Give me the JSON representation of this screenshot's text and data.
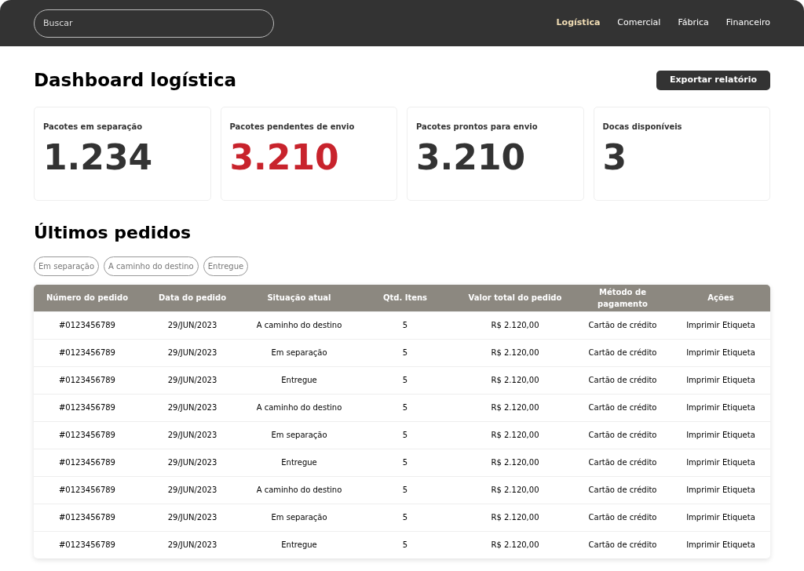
{
  "search": {
    "placeholder": "Buscar"
  },
  "nav": [
    {
      "label": "Logística",
      "selected": true
    },
    {
      "label": "Comercial",
      "selected": false
    },
    {
      "label": "Fábrica",
      "selected": false
    },
    {
      "label": "Financeiro",
      "selected": false
    }
  ],
  "page_title": "Dashboard logística",
  "export_button": "Exportar relatório",
  "stats": [
    {
      "label": "Pacotes em separação",
      "value": "1.234",
      "alert": false
    },
    {
      "label": "Pacotes pendentes de envio",
      "value": "3.210",
      "alert": true
    },
    {
      "label": "Pacotes prontos para envio",
      "value": "3.210",
      "alert": false
    },
    {
      "label": "Docas disponíveis",
      "value": "3",
      "alert": false
    }
  ],
  "orders_title": "Últimos pedidos",
  "filters": [
    "Em separação",
    "A caminho do destino",
    "Entregue"
  ],
  "table": {
    "columns": [
      "Número do pedido",
      "Data do pedido",
      "Situação atual",
      "Qtd. Itens",
      "Valor total do pedido",
      "Método de pagamento",
      "Ações"
    ],
    "rows": [
      [
        "#0123456789",
        "29/JUN/2023",
        "A caminho do destino",
        "5",
        "R$ 2.120,00",
        "Cartão de crédito",
        "Imprimir Etiqueta"
      ],
      [
        "#0123456789",
        "29/JUN/2023",
        "Em separação",
        "5",
        "R$ 2.120,00",
        "Cartão de crédito",
        "Imprimir Etiqueta"
      ],
      [
        "#0123456789",
        "29/JUN/2023",
        "Entregue",
        "5",
        "R$ 2.120,00",
        "Cartão de crédito",
        "Imprimir Etiqueta"
      ],
      [
        "#0123456789",
        "29/JUN/2023",
        "A caminho do destino",
        "5",
        "R$ 2.120,00",
        "Cartão de crédito",
        "Imprimir Etiqueta"
      ],
      [
        "#0123456789",
        "29/JUN/2023",
        "Em separação",
        "5",
        "R$ 2.120,00",
        "Cartão de crédito",
        "Imprimir Etiqueta"
      ],
      [
        "#0123456789",
        "29/JUN/2023",
        "Entregue",
        "5",
        "R$ 2.120,00",
        "Cartão de crédito",
        "Imprimir Etiqueta"
      ],
      [
        "#0123456789",
        "29/JUN/2023",
        "A caminho do destino",
        "5",
        "R$ 2.120,00",
        "Cartão de crédito",
        "Imprimir Etiqueta"
      ],
      [
        "#0123456789",
        "29/JUN/2023",
        "Em separação",
        "5",
        "R$ 2.120,00",
        "Cartão de crédito",
        "Imprimir Etiqueta"
      ],
      [
        "#0123456789",
        "29/JUN/2023",
        "Entregue",
        "5",
        "R$ 2.120,00",
        "Cartão de crédito",
        "Imprimir Etiqueta"
      ]
    ]
  }
}
